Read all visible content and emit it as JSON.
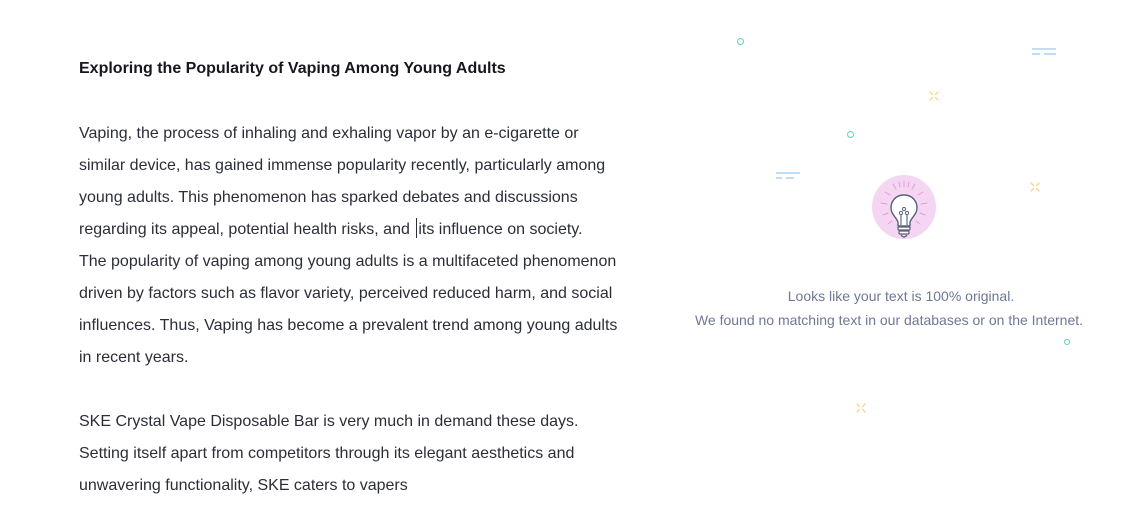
{
  "document": {
    "title": "Exploring the Popularity of Vaping Among Young Adults",
    "paragraph1_before_caret": "Vaping, the process of inhaling and exhaling vapor by an e-cigarette or similar device, has gained immense popularity recently, particularly among young adults. This phenomenon has sparked debates and discussions regarding its appeal, potential health risks, and ",
    "paragraph1_after_caret": "its influence on society.",
    "paragraph2": "The popularity of vaping among young adults is a multifaceted phenomenon driven by factors such as flavor variety, perceived reduced harm, and social influences. Thus, Vaping has become a prevalent trend among young adults in recent years.",
    "paragraph3": "SKE Crystal Vape Disposable Bar is very much in demand these days. Setting itself apart from competitors through its elegant aesthetics and unwavering functionality, SKE caters to vapers"
  },
  "result": {
    "icon": "lightbulb-icon",
    "line1": "Looks like your text is 100% original.",
    "line2": "We found no matching text in our databases or on the Internet."
  },
  "colors": {
    "text": "#2a2e38",
    "result_text": "#6f7795",
    "bulb_glow": "#f3cdf0",
    "accent_teal": "#5fd6b6",
    "accent_yellow": "#f7d58a",
    "accent_blue": "#9ec8ee"
  }
}
